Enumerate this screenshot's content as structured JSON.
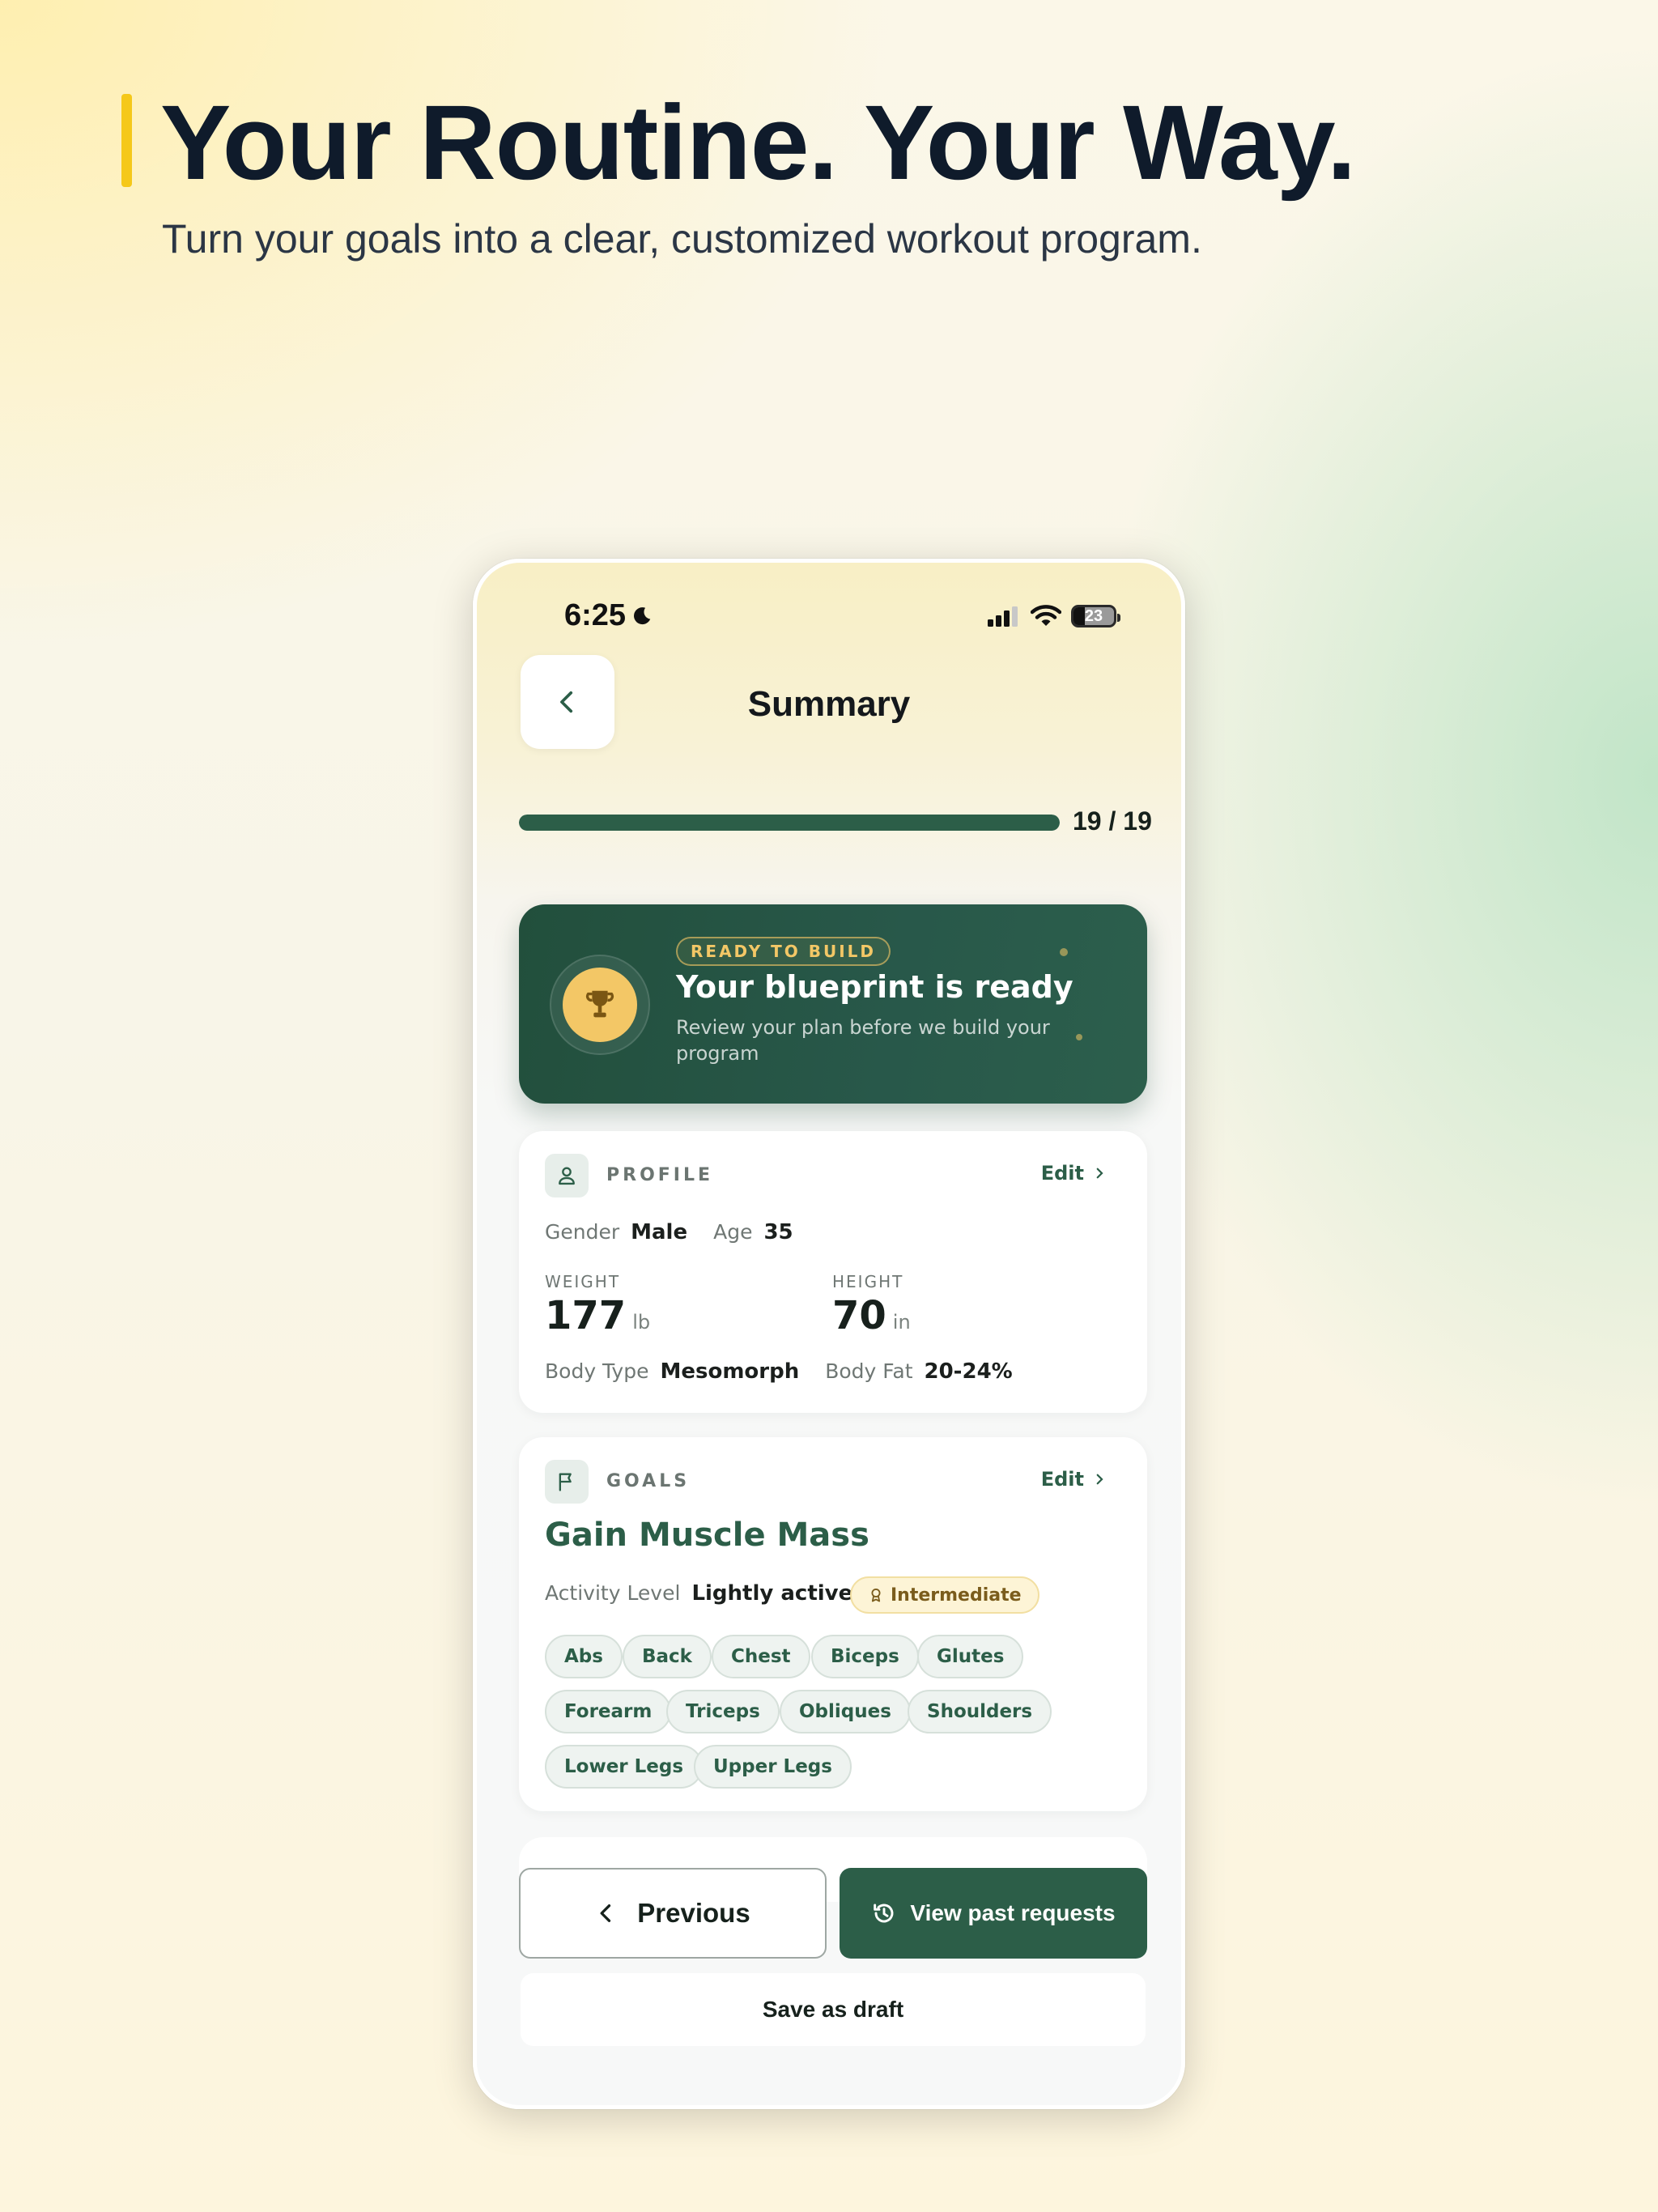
{
  "hero": {
    "title": "Your Routine. Your Way.",
    "subtitle": "Turn your goals into a clear, customized workout program."
  },
  "status_bar": {
    "time": "6:25",
    "battery": "23"
  },
  "header": {
    "title": "Summary",
    "progress_text": "19 / 19",
    "progress_fraction": 1.0
  },
  "ready_card": {
    "badge": "READY TO BUILD",
    "title": "Your blueprint is ready",
    "description": "Review your plan before we build your program"
  },
  "profile": {
    "heading": "PROFILE",
    "edit_label": "Edit",
    "gender_label": "Gender",
    "gender_value": "Male",
    "age_label": "Age",
    "age_value": "35",
    "weight_label": "WEIGHT",
    "weight_value": "177",
    "weight_unit": "lb",
    "height_label": "HEIGHT",
    "height_value": "70",
    "height_unit": "in",
    "body_type_label": "Body Type",
    "body_type_value": "Mesomorph",
    "body_fat_label": "Body Fat",
    "body_fat_value": "20-24%"
  },
  "goals": {
    "heading": "GOALS",
    "edit_label": "Edit",
    "goal": "Gain Muscle Mass",
    "activity_label": "Activity Level",
    "activity_value": "Lightly active",
    "level": "Intermediate",
    "muscles": [
      "Abs",
      "Back",
      "Chest",
      "Biceps",
      "Glutes",
      "Forearm",
      "Triceps",
      "Obliques",
      "Shoulders",
      "Lower Legs",
      "Upper Legs"
    ]
  },
  "actions": {
    "previous": "Previous",
    "view_past": "View past requests",
    "save_draft": "Save as draft"
  },
  "colors": {
    "accent_green": "#2c5e48",
    "gold": "#f3c766",
    "headline_bar": "#f5c81a"
  }
}
